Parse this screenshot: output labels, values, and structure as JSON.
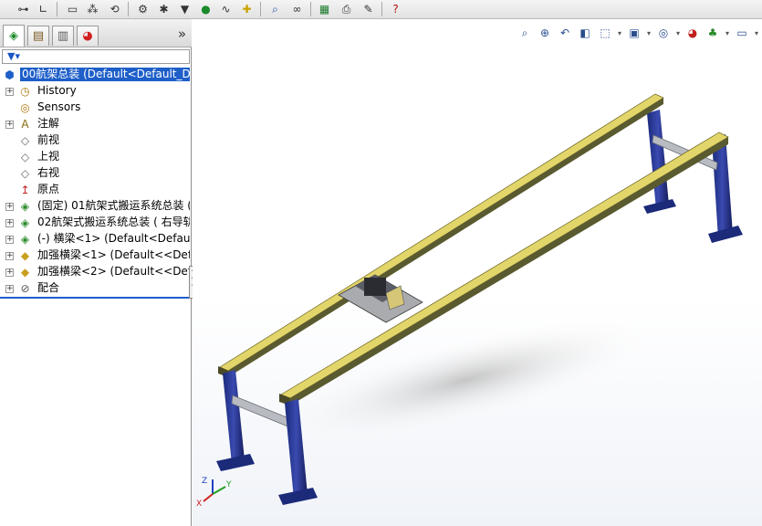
{
  "toolbar": {
    "icons": [
      "measure-icon",
      "dimension-icon",
      "display-icon",
      "assembly-icon",
      "rebuild-icon",
      "options-icon",
      "gear-icon",
      "funnel-icon",
      "location-icon",
      "spring-icon",
      "move-component-icon",
      "search-icon",
      "binoculars-icon",
      "excel-icon",
      "print-icon",
      "insert-icon",
      "help-icon"
    ]
  },
  "panel": {
    "tabs": [
      "feature-manager-tab",
      "property-manager-tab",
      "configuration-manager-tab",
      "display-manager-tab"
    ],
    "expand_label": "»"
  },
  "tree": {
    "root": "00航架总装  (Default<Default_Di",
    "items": [
      {
        "label": "History",
        "icon": "history-icon",
        "toggle": "+"
      },
      {
        "label": "Sensors",
        "icon": "sensor-icon",
        "toggle": ""
      },
      {
        "label": "注解",
        "icon": "annotation-icon",
        "toggle": "+"
      },
      {
        "label": "前视",
        "icon": "plane-icon",
        "toggle": ""
      },
      {
        "label": "上视",
        "icon": "plane-icon",
        "toggle": ""
      },
      {
        "label": "右视",
        "icon": "plane-icon",
        "toggle": ""
      },
      {
        "label": "原点",
        "icon": "origin-icon",
        "toggle": ""
      },
      {
        "label": "(固定) 01航架式搬运系统总装 (",
        "icon": "subassembly-icon",
        "toggle": "+"
      },
      {
        "label": "02航架式搬运系统总装 ( 右导轨",
        "icon": "subassembly-icon",
        "toggle": "+"
      },
      {
        "label": "(-) 横梁<1> (Default<Default",
        "icon": "subassembly-icon",
        "toggle": "+"
      },
      {
        "label": "加强横梁<1> (Default<<Defa",
        "icon": "part-icon",
        "toggle": "+"
      },
      {
        "label": "加强横梁<2> (Default<<Defa",
        "icon": "part-icon",
        "toggle": "+"
      },
      {
        "label": "配合",
        "icon": "mates-icon",
        "toggle": "+"
      }
    ]
  },
  "view_toolbar": {
    "icons": [
      "zoom-to-fit-icon",
      "zoom-area-icon",
      "previous-view-icon",
      "section-view-icon",
      "view-orientation-icon",
      "display-style-icon",
      "hide-show-icon",
      "appearance-icon",
      "scene-icon",
      "monitor-icon"
    ]
  },
  "triad": {
    "x": "X",
    "y": "Y",
    "z": "Z"
  }
}
